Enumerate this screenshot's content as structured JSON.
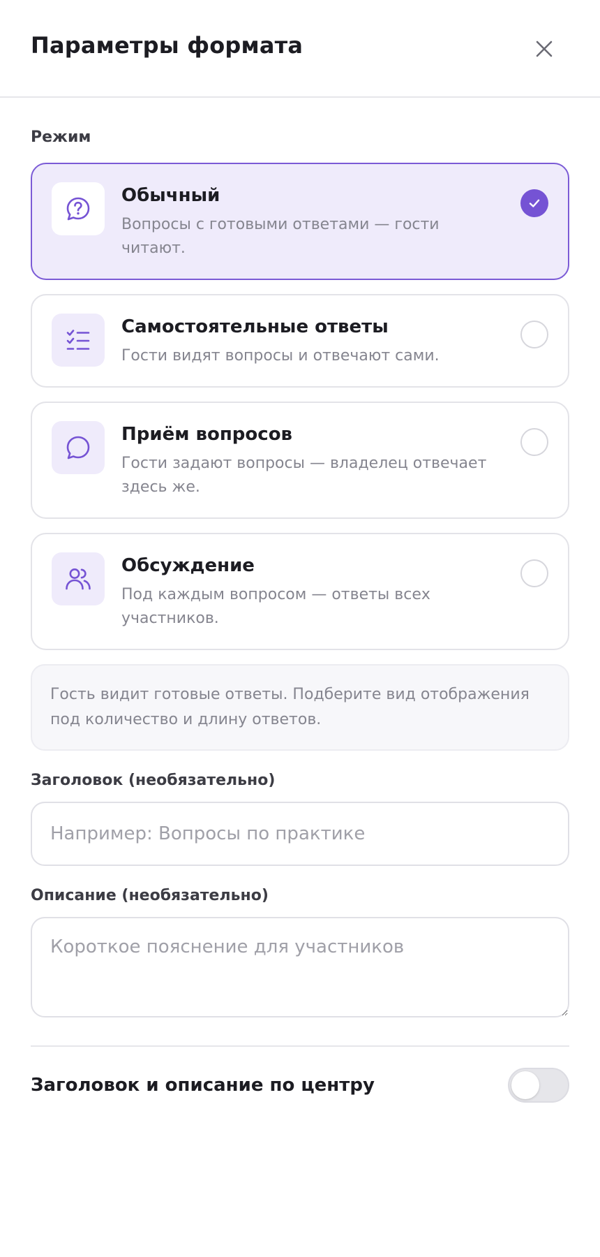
{
  "header": {
    "title": "Параметры формата",
    "close_icon": "close-icon"
  },
  "mode_section": {
    "label": "Режим",
    "selected": "regular",
    "options": [
      {
        "id": "regular",
        "title": "Обычный",
        "description": "Вопросы с готовыми ответами — гости читают.",
        "icon": "question-bubble-icon",
        "selected": true
      },
      {
        "id": "self-answers",
        "title": "Самостоятельные ответы",
        "description": "Гости видят вопросы и отвечают сами.",
        "icon": "checklist-icon",
        "selected": false
      },
      {
        "id": "question-intake",
        "title": "Приём вопросов",
        "description": "Гости задают вопросы — владелец отвечает здесь же.",
        "icon": "chat-bubble-icon",
        "selected": false
      },
      {
        "id": "discussion",
        "title": "Обсуждение",
        "description": "Под каждым вопросом — ответы всех участников.",
        "icon": "users-icon",
        "selected": false
      }
    ]
  },
  "info_text": "Гость видит готовые ответы. Подберите вид отображения под количество и длину ответов.",
  "title_field": {
    "label": "Заголовок (необязательно)",
    "value": "",
    "placeholder": "Например: Вопросы по практике"
  },
  "description_field": {
    "label": "Описание (необязательно)",
    "value": "",
    "placeholder": "Короткое пояснение для участников"
  },
  "center_toggle": {
    "label": "Заголовок и описание по центру",
    "on": false
  },
  "colors": {
    "accent": "#7553D4",
    "accent_light": "#EFEBFB",
    "border": "#E3E3E8",
    "muted_text": "#85858F"
  }
}
